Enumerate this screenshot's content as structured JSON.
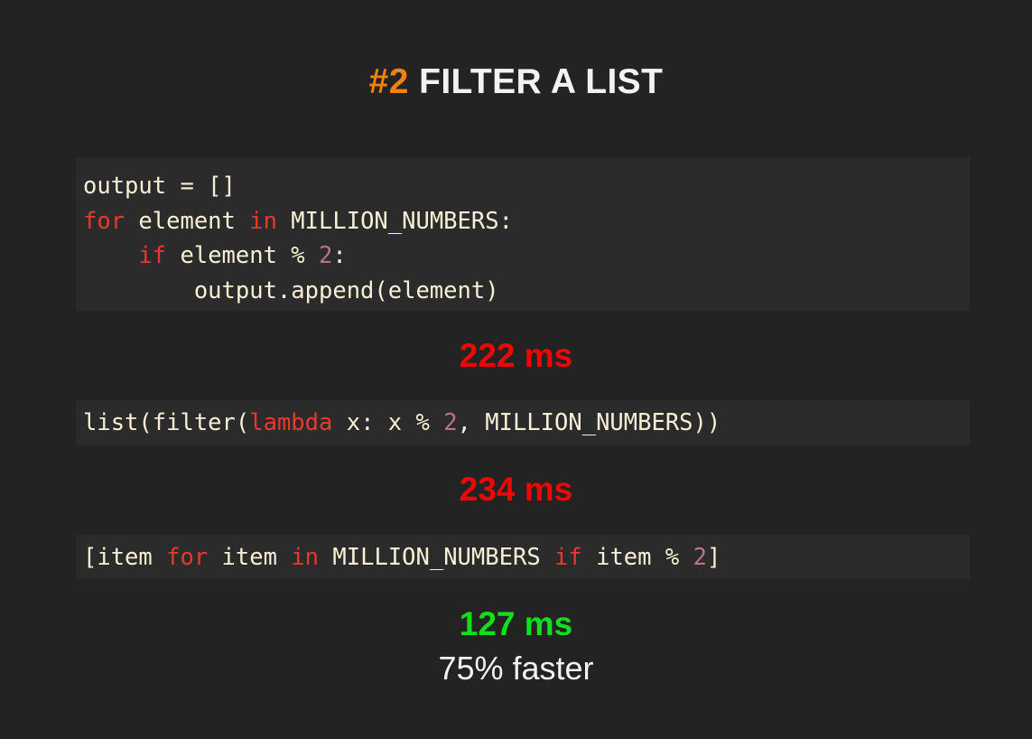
{
  "slide": {
    "background_color": "#232323",
    "title": {
      "number": "#2",
      "number_color": "#f0820f",
      "text": "FILTER A LIST",
      "text_color": "#f2f2f2"
    },
    "code_block_background": "#2b2b2b",
    "code_text_color": "#f7f0d6",
    "keyword_color": "#e8392f",
    "number_literal_color": "#b9728b",
    "slow_color": "#f00505",
    "fast_color": "#12e01f"
  },
  "benchmarks": [
    {
      "name": "for-loop-append",
      "code_lines": [
        [
          {
            "t": "output = []",
            "c": "plain"
          }
        ],
        [
          {
            "t": "for",
            "c": "kw"
          },
          {
            "t": " element ",
            "c": "plain"
          },
          {
            "t": "in",
            "c": "kw"
          },
          {
            "t": " MILLION_NUMBERS:",
            "c": "plain"
          }
        ],
        [
          {
            "t": "    ",
            "c": "plain"
          },
          {
            "t": "if",
            "c": "kw"
          },
          {
            "t": " element % ",
            "c": "plain"
          },
          {
            "t": "2",
            "c": "num"
          },
          {
            "t": ":",
            "c": "plain"
          }
        ],
        [
          {
            "t": "        output.append(element)",
            "c": "plain"
          }
        ]
      ],
      "timing": "222 ms",
      "timing_kind": "slow"
    },
    {
      "name": "list-filter-lambda",
      "code_lines": [
        [
          {
            "t": "list(filter(",
            "c": "plain"
          },
          {
            "t": "lambda",
            "c": "kw"
          },
          {
            "t": " x: x % ",
            "c": "plain"
          },
          {
            "t": "2",
            "c": "num"
          },
          {
            "t": ", MILLION_NUMBERS))",
            "c": "plain"
          }
        ]
      ],
      "timing": "234 ms",
      "timing_kind": "slow"
    },
    {
      "name": "list-comprehension",
      "code_lines": [
        [
          {
            "t": "[item ",
            "c": "plain"
          },
          {
            "t": "for",
            "c": "kw"
          },
          {
            "t": " item ",
            "c": "plain"
          },
          {
            "t": "in",
            "c": "kw"
          },
          {
            "t": " MILLION_NUMBERS ",
            "c": "plain"
          },
          {
            "t": "if",
            "c": "kw"
          },
          {
            "t": " item % ",
            "c": "plain"
          },
          {
            "t": "2",
            "c": "num"
          },
          {
            "t": "]",
            "c": "plain"
          }
        ]
      ],
      "timing": "127 ms",
      "timing_kind": "fast"
    }
  ],
  "summary": {
    "faster_label": "75% faster"
  }
}
